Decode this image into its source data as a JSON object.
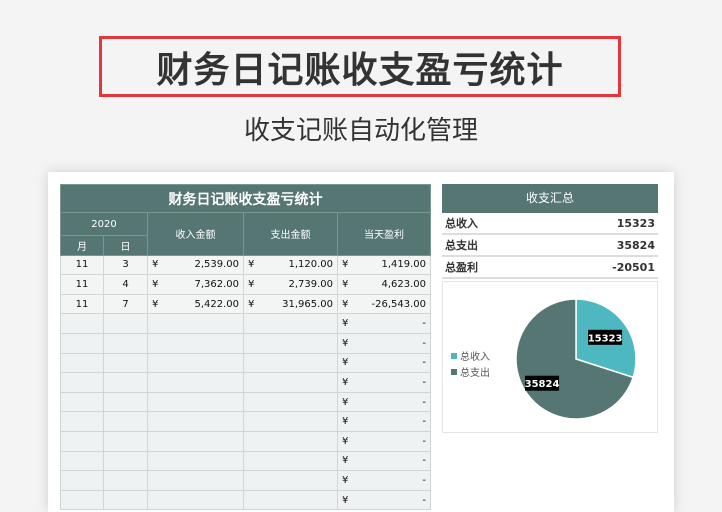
{
  "banner": {
    "title": "财务日记账收支盈亏统计",
    "subtitle": "收支记账自动化管理"
  },
  "sheet": {
    "title": "财务日记账收支盈亏统计",
    "year": "2020",
    "month": "月",
    "day": "日",
    "income": "收入金额",
    "expense": "支出金额",
    "profit": "当天盈利",
    "currency": "¥",
    "empty": "-",
    "rows": [
      {
        "m": "11",
        "d": "3",
        "in": "2,539.00",
        "out": "1,120.00",
        "p": "1,419.00"
      },
      {
        "m": "11",
        "d": "4",
        "in": "7,362.00",
        "out": "2,739.00",
        "p": "4,623.00"
      },
      {
        "m": "11",
        "d": "7",
        "in": "5,422.00",
        "out": "31,965.00",
        "p": "-26,543.00"
      }
    ]
  },
  "summary": {
    "title": "收支汇总",
    "rows": [
      {
        "label": "总收入",
        "value": "15323"
      },
      {
        "label": "总支出",
        "value": "35824"
      },
      {
        "label": "总盈利",
        "value": "-20501"
      }
    ]
  },
  "chart_data": {
    "type": "pie",
    "labels": [
      "总收入",
      "总支出"
    ],
    "values": [
      15323,
      35824
    ],
    "colors": [
      "#4db8bf",
      "#557673"
    ],
    "legend": "left"
  }
}
